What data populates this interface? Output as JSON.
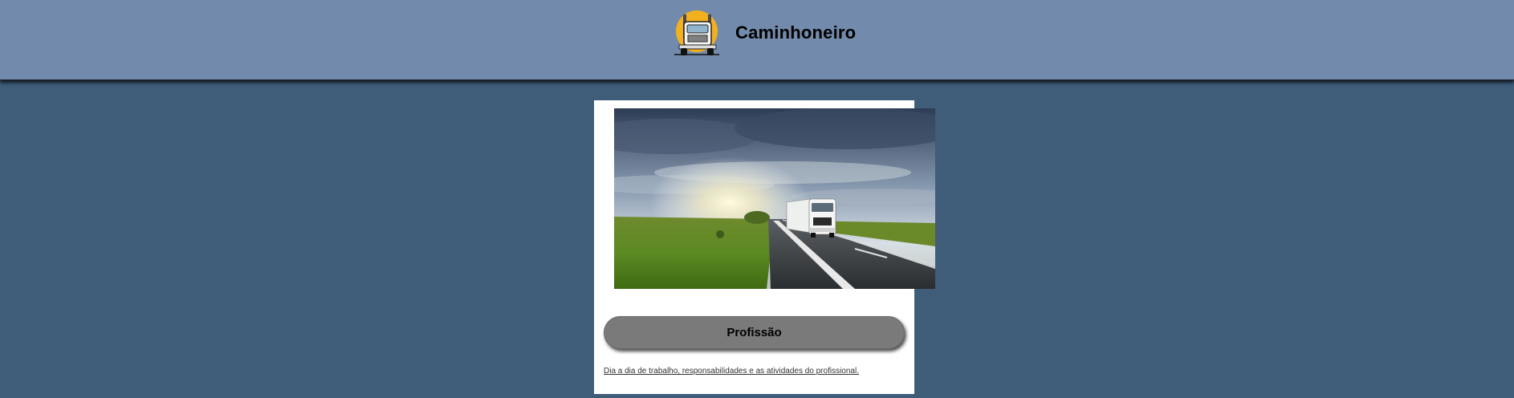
{
  "header": {
    "title": "Caminhoneiro",
    "logo_icon": "truck-logo-icon"
  },
  "card": {
    "image": "truck-on-highway-photo",
    "button_label": "Profissão",
    "description": "Dia a dia de trabalho, responsabilidades e as atividades do profissional."
  },
  "colors": {
    "page_background": "#3f5c79",
    "header_background": "#728aab",
    "logo_sun": "#f2b01e",
    "button_background": "#7a7a7a"
  }
}
